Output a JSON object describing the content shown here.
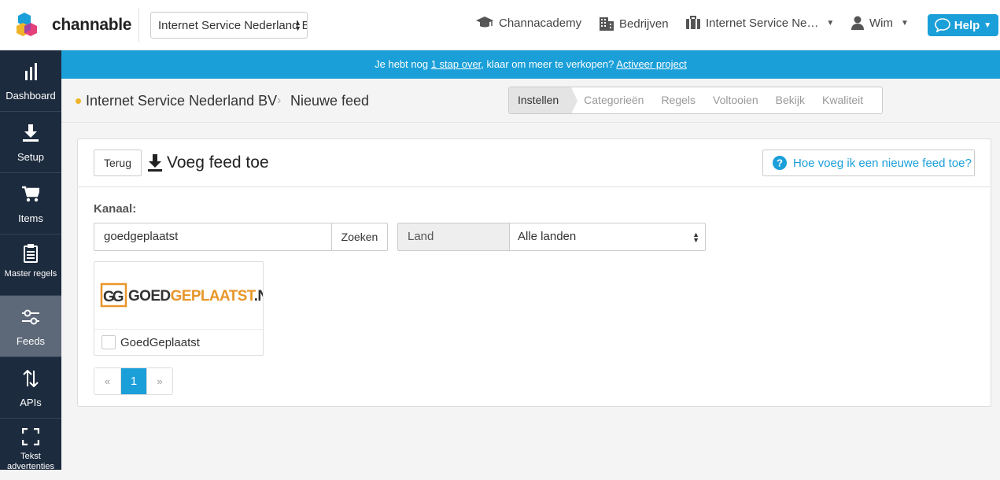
{
  "header": {
    "logo_text": "channable",
    "project_select": "Internet Service Nederland BV",
    "nav": {
      "academy": "Channacademy",
      "companies": "Bedrijven",
      "project": "Internet Service Ne…",
      "user": "Wim"
    },
    "help": "Help"
  },
  "sidebar": {
    "items": [
      {
        "label": "Dashboard",
        "icon": "bar-chart-icon"
      },
      {
        "label": "Setup",
        "icon": "download-icon"
      },
      {
        "label": "Items",
        "icon": "cart-icon"
      },
      {
        "label": "Master regels",
        "icon": "clipboard-icon"
      },
      {
        "label": "Feeds",
        "icon": "sliders-icon"
      },
      {
        "label": "APIs",
        "icon": "arrows-updown-icon"
      },
      {
        "label": "Tekst advertenties",
        "icon": "expand-icon"
      }
    ]
  },
  "banner": {
    "prefix": "Je hebt nog ",
    "link1": "1 stap over",
    "middle": ", klaar om meer te verkopen? ",
    "link2": "Activeer project"
  },
  "breadcrumb": {
    "company": "Internet Service Nederland BV",
    "separator": "›",
    "page": "Nieuwe feed"
  },
  "steps": [
    "Instellen",
    "Categorieën",
    "Regels",
    "Voltooien",
    "Bekijk",
    "Kwaliteit"
  ],
  "panel": {
    "back": "Terug",
    "title": "Voeg feed toe",
    "howto": "Hoe voeg ik een nieuwe feed toe?",
    "kanaal_label": "Kanaal:",
    "search_value": "goedgeplaatst",
    "search_button": "Zoeken",
    "land_label": "Land",
    "land_value": "Alle landen"
  },
  "results": [
    {
      "name": "GoedGeplaatst",
      "logo_text_dark": "GOED",
      "logo_text_orange": "GEPLAATST",
      "logo_text_suffix": ".NL",
      "checked": false
    }
  ],
  "pagination": {
    "prev": "«",
    "current": "1",
    "next": "»"
  },
  "colors": {
    "accent": "#1a9fd9",
    "sidebar": "#1d2b3e",
    "logo_orange": "#e8962a"
  }
}
